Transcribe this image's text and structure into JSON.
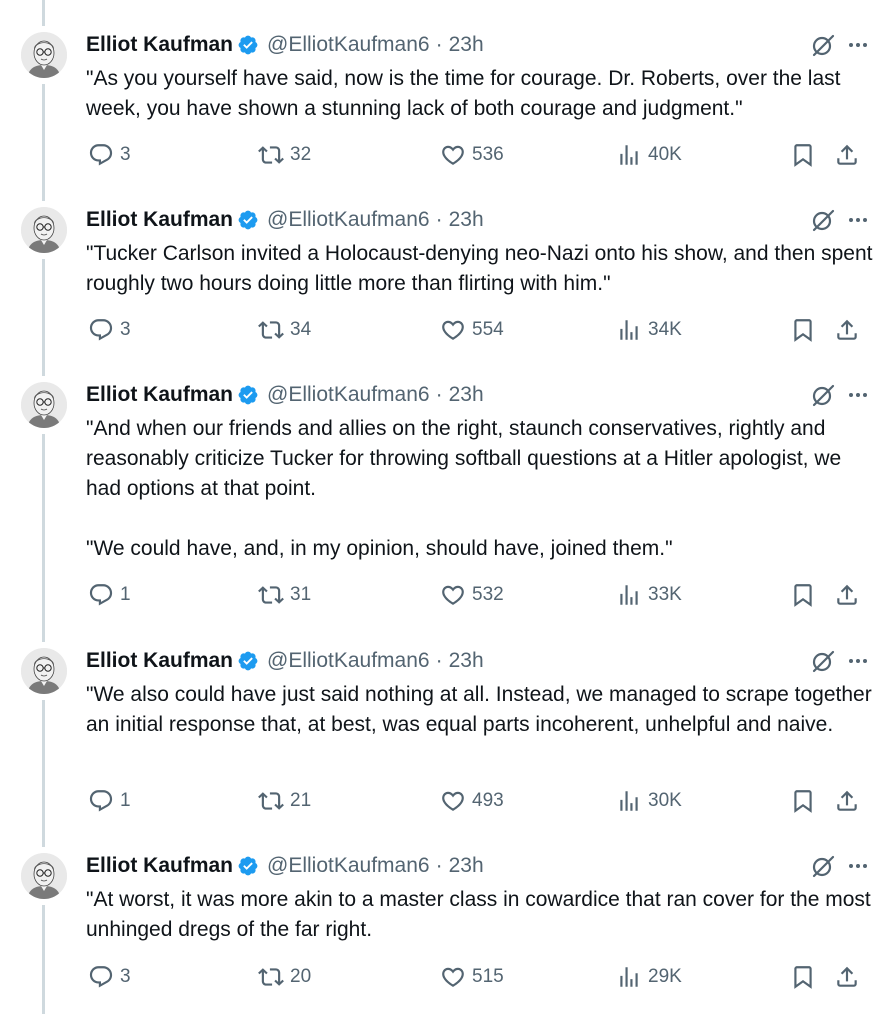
{
  "author": {
    "name": "Elliot Kaufman",
    "handle": "@ElliotKaufman6",
    "separator": "·",
    "verified_color": "#1d9bf0"
  },
  "icons": {
    "grok": "grok-icon",
    "more": "more-icon",
    "reply": "reply-icon",
    "repost": "repost-icon",
    "like": "like-icon",
    "views": "views-icon",
    "bookmark": "bookmark-icon",
    "share": "share-icon",
    "verified": "verified-badge-icon"
  },
  "colors": {
    "text": "#0f1419",
    "secondary": "#536471",
    "thread_line": "#cfd9de"
  },
  "tweets": [
    {
      "time": "23h",
      "paragraphs": [
        "\"As you yourself have said, now is the time for courage. Dr. Roberts, over the last week, you have shown a stunning lack of both courage and judgment.\""
      ],
      "replies": "3",
      "reposts": "32",
      "likes": "536",
      "views": "40K"
    },
    {
      "time": "23h",
      "paragraphs": [
        "\"Tucker Carlson invited a Holocaust-denying neo-Nazi onto his show, and then spent roughly two hours doing little more than flirting with him.\""
      ],
      "replies": "3",
      "reposts": "34",
      "likes": "554",
      "views": "34K"
    },
    {
      "time": "23h",
      "paragraphs": [
        "\"And when our friends and allies on the right, staunch conservatives, rightly and reasonably criticize Tucker for throwing softball questions at a Hitler apologist, we had options at that point.",
        "\"We could have, and, in my opinion, should have, joined them.\""
      ],
      "replies": "1",
      "reposts": "31",
      "likes": "532",
      "views": "33K"
    },
    {
      "time": "23h",
      "paragraphs": [
        "\"We also could have just said nothing at all. Instead, we managed to scrape together an initial response that, at best, was equal parts incoherent, unhelpful and naive."
      ],
      "replies": "1",
      "reposts": "21",
      "likes": "493",
      "views": "30K"
    },
    {
      "time": "23h",
      "paragraphs": [
        "\"At worst, it was more akin to a master class in cowardice that ran cover for the most unhinged dregs of the far right."
      ],
      "replies": "3",
      "reposts": "20",
      "likes": "515",
      "views": "29K"
    }
  ]
}
